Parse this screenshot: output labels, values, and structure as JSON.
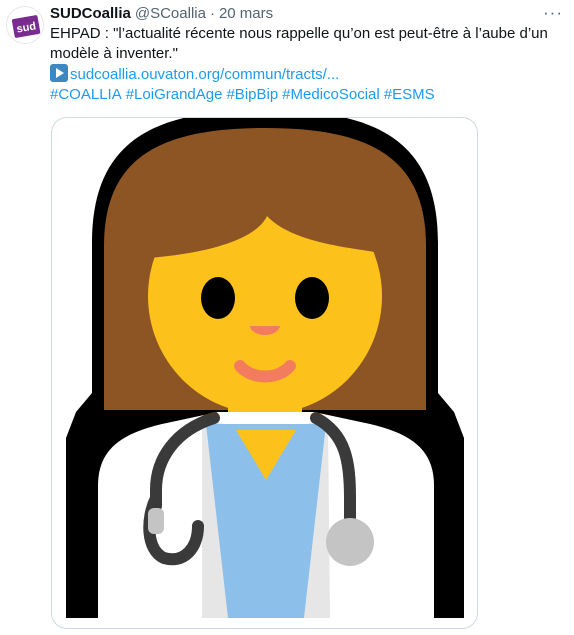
{
  "tweet": {
    "avatar_label": "sud",
    "name": "SUDCoallia",
    "handle": "@SCoallia",
    "separator": "·",
    "date": "20 mars",
    "more": "···",
    "text_line1": "EHPAD : \"l’actualité récente nous rappelle qu’on est peut-être à l’aube d’un",
    "text_line2": "modèle à inventer.\"",
    "link": "sudcoallia.ouvaton.org/commun/tracts/...",
    "hashtags": [
      "#COALLIA",
      "#LoiGrandAge",
      "#BipBip",
      "#MedicoSocial",
      "#ESMS"
    ]
  },
  "media": {
    "icon": "woman-health-worker-emoji",
    "colors": {
      "outline": "#000000",
      "hair": "#8d5524",
      "skin": "#fcc21b",
      "coat": "#ffffff",
      "coat_shadow": "#e6e6e6",
      "scrubs": "#8cc0ea",
      "stethoscope": "#3a3a3a",
      "stethoscope_light": "#c4c4c4",
      "cheek": "#f47c5e"
    }
  }
}
